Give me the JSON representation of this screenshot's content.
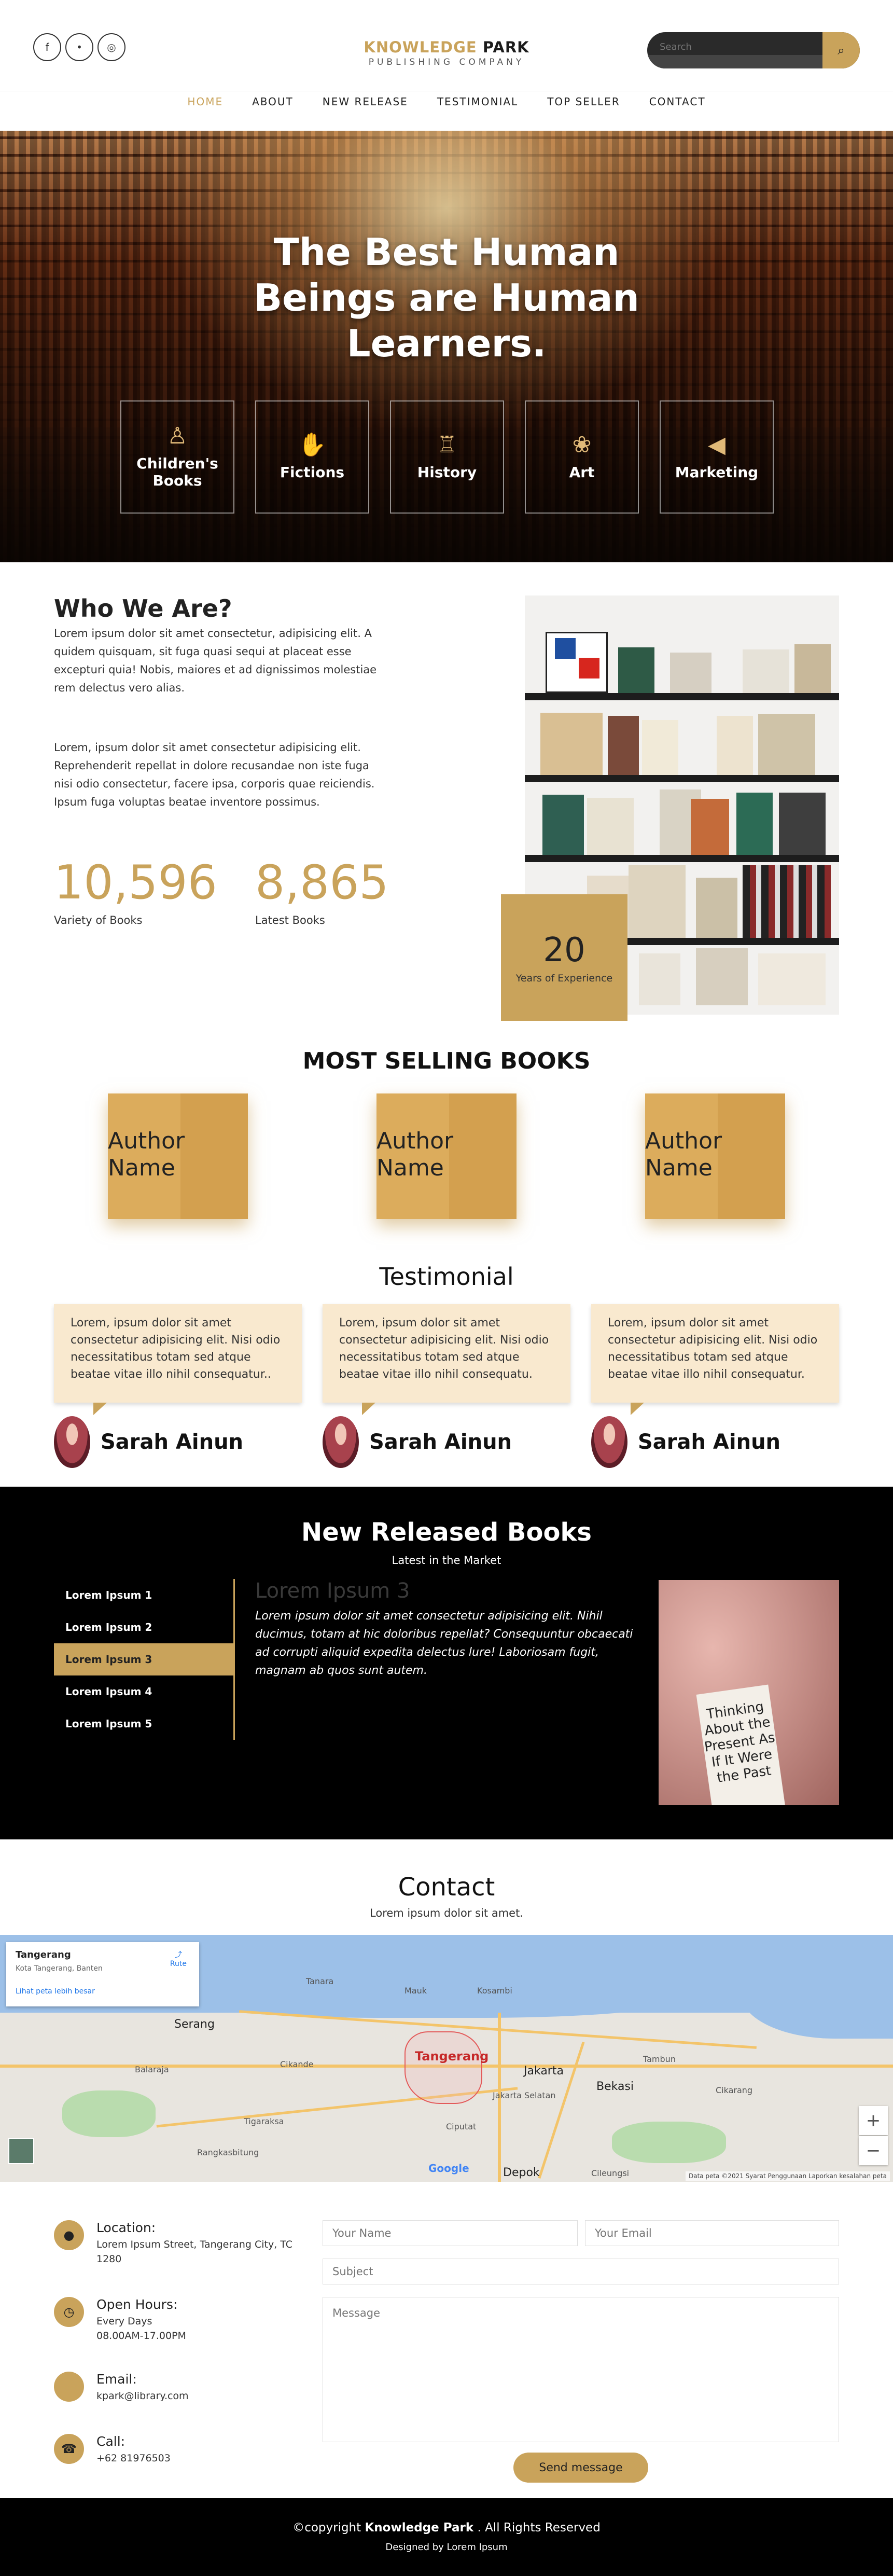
{
  "header": {
    "socials": [
      {
        "icon": "facebook-icon",
        "glyph": "f"
      },
      {
        "icon": "twitter-icon",
        "glyph": "•"
      },
      {
        "icon": "instagram-icon",
        "glyph": "◎"
      }
    ],
    "logo_main": "KNOWLEDGE",
    "logo_bold": "PARK",
    "logo_sub": "PUBLISHING COMPANY",
    "search_placeholder": "Search"
  },
  "nav": [
    "HOME",
    "ABOUT",
    "NEW RELEASE",
    "TESTIMONIAL",
    "TOP SELLER",
    "CONTACT"
  ],
  "hero": {
    "title": "The Best Human Beings are Human Learners.",
    "categories": [
      {
        "label": "Children's Books",
        "icon": "child-icon"
      },
      {
        "label": "Fictions",
        "icon": "hand-icon"
      },
      {
        "label": "History",
        "icon": "monument-icon"
      },
      {
        "label": "Art",
        "icon": "palette-icon"
      },
      {
        "label": "Marketing",
        "icon": "megaphone-icon"
      }
    ]
  },
  "about": {
    "title": "Who We Are?",
    "p1": "Lorem ipsum dolor sit amet consectetur, adipisicing elit. A quidem quisquam, sit fuga quasi sequi at placeat esse excepturi quia! Nobis, maiores et ad dignissimos molestiae rem delectus vero alias.",
    "p2": "Lorem, ipsum dolor sit amet consectetur adipisicing elit. Reprehenderit repellat in dolore recusandae non iste fuga nisi odio consectetur, facere ipsa, corporis quae reiciendis. Ipsum fuga voluptas beatae inventore possimus.",
    "stats": [
      {
        "value": "10,596",
        "label": "Variety of Books"
      },
      {
        "value": "8,865",
        "label": "Latest Books"
      }
    ],
    "experience_value": "20",
    "experience_label": "Years of Experience"
  },
  "best_sellers": {
    "title": "MOST SELLING BOOKS",
    "books": [
      {
        "label": "Author Name"
      },
      {
        "label": "Author Name"
      },
      {
        "label": "Author Name"
      }
    ]
  },
  "testimonial": {
    "title": "Testimonial",
    "items": [
      {
        "text": "Lorem, ipsum dolor sit amet consectetur adipisicing elit. Nisi odio necessitatibus totam sed atque beatae vitae illo nihil consequatur..",
        "name": "Sarah Ainun"
      },
      {
        "text": "Lorem, ipsum dolor sit amet consectetur adipisicing elit. Nisi odio necessitatibus totam sed atque beatae vitae illo nihil consequatu.",
        "name": "Sarah Ainun"
      },
      {
        "text": "Lorem, ipsum dolor sit amet consectetur adipisicing elit. Nisi odio necessitatibus totam sed atque beatae vitae illo nihil consequatur.",
        "name": "Sarah Ainun"
      }
    ]
  },
  "releases": {
    "title": "New Released Books",
    "subtitle": "Latest in the Market",
    "items": [
      "Lorem Ipsum 1",
      "Lorem Ipsum 2",
      "Lorem Ipsum 3",
      "Lorem Ipsum 4",
      "Lorem Ipsum 5"
    ],
    "active_index": 2,
    "active_title": "Lorem Ipsum 3",
    "active_text": "Lorem ipsum dolor sit amet consectetur adipisicing elit. Nihil ducimus, totam at hic doloribus repellat? Consequuntur obcaecati ad corrupti aliquid expedita delectus lure! Laboriosam fugit, magnam ab quos sunt autem.",
    "image_text": "Thinking About the Present As If It Were the Past"
  },
  "contact": {
    "title": "Contact",
    "subtitle": "Lorem ipsum dolor sit amet.",
    "map": {
      "place": "Tangerang",
      "address": "Kota Tangerang, Banten",
      "link": "Lihat peta lebih besar",
      "route": "Rute",
      "city_label": "Tangerang",
      "google": "Google",
      "footer": "Data peta ©2021   Syarat Penggunaan   Laporkan kesalahan peta",
      "labels": [
        "Tanara",
        "Kosambi",
        "Mauk",
        "Jakarta",
        "Jakarta Selatan",
        "Bekasi",
        "Depok",
        "Cileungsi",
        "Serang",
        "Cikande",
        "Balaraja",
        "Tigaraksa",
        "Rangkasbitung",
        "Ciputat",
        "Cikarang",
        "Tambun"
      ]
    },
    "items": [
      {
        "icon": "location-icon",
        "glyph": "●",
        "title": "Location:",
        "text": "Lorem Ipsum Street, Tangerang City, TC 1280"
      },
      {
        "icon": "clock-icon",
        "glyph": "◷",
        "title": "Open Hours:",
        "text": "Every Days\n08.00AM-17.00PM"
      },
      {
        "icon": "email-icon",
        "glyph": "",
        "title": "Email:",
        "text": "kpark@library.com"
      },
      {
        "icon": "phone-icon",
        "glyph": "☎",
        "title": "Call:",
        "text": "+62 81976503"
      }
    ],
    "form": {
      "name_placeholder": "Your Name",
      "email_placeholder": "Your Email",
      "subject_placeholder": "Subject",
      "message_placeholder": "Message",
      "send_label": "Send message"
    }
  },
  "footer": {
    "copyright_prefix": "©copyright ",
    "copyright_brand": "Knowledge Park",
    "copyright_suffix": " . All Rights Reserved",
    "designed": "Designed by Lorem Ipsum"
  },
  "colors": {
    "accent": "#c9a35b",
    "dark": "#000000",
    "card": "#f9e9cf"
  }
}
